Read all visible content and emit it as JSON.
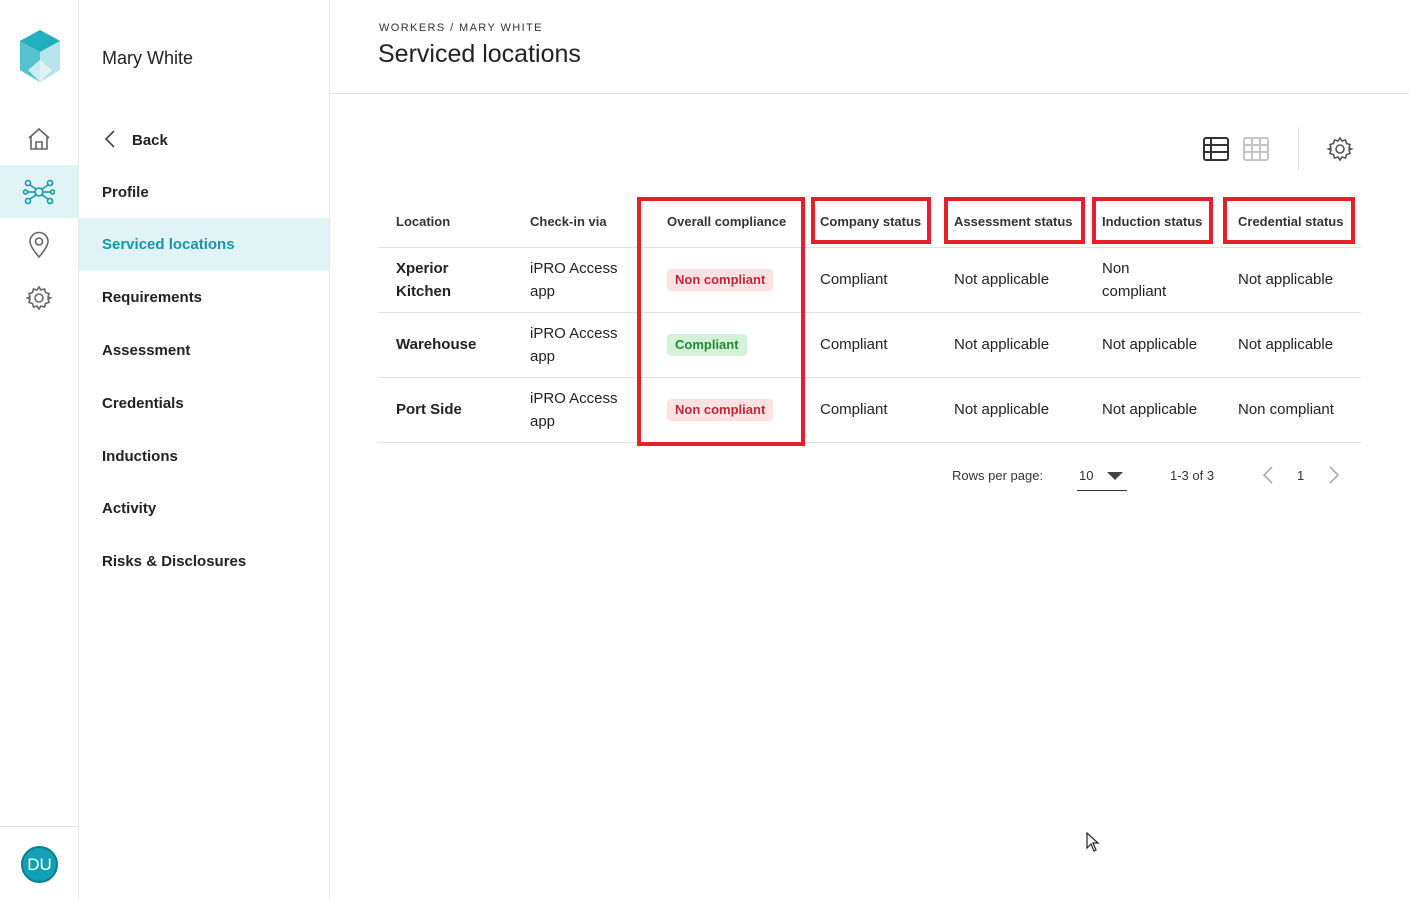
{
  "app": {
    "accent": "#1497a8",
    "highlight_color": "#e5202a"
  },
  "rail": {
    "logo": "app-logo",
    "items": [
      {
        "icon": "home-icon",
        "active": false
      },
      {
        "icon": "network-icon",
        "active": true
      },
      {
        "icon": "location-pin-icon",
        "active": false
      },
      {
        "icon": "gear-icon",
        "active": false
      }
    ],
    "avatar_initials": "DU"
  },
  "sidebar": {
    "worker_name": "Mary White",
    "back_label": "Back",
    "items": [
      {
        "label": "Profile",
        "active": false
      },
      {
        "label": "Serviced locations",
        "active": true
      },
      {
        "label": "Requirements",
        "active": false
      },
      {
        "label": "Assessment",
        "active": false
      },
      {
        "label": "Credentials",
        "active": false
      },
      {
        "label": "Inductions",
        "active": false
      },
      {
        "label": "Activity",
        "active": false
      },
      {
        "label": "Risks & Disclosures",
        "active": false
      }
    ]
  },
  "header": {
    "breadcrumb": "WORKERS / MARY WHITE",
    "title": "Serviced locations"
  },
  "toolbar": {
    "list_view_icon": "table-view-icon",
    "grid_view_icon": "grid-view-icon",
    "settings_icon": "gear-icon"
  },
  "table": {
    "columns": [
      "Location",
      "Check-in via",
      "Overall compliance",
      "Company status",
      "Assessment status",
      "Induction status",
      "Credential status"
    ],
    "rows": [
      {
        "location": "Xperior Kitchen",
        "checkin": "iPRO Access app",
        "overall": "Non compliant",
        "overall_status": "bad",
        "company": "Compliant",
        "assessment": "Not applicable",
        "induction": "Non compliant",
        "credential": "Not applicable"
      },
      {
        "location": "Warehouse",
        "checkin": "iPRO Access app",
        "overall": "Compliant",
        "overall_status": "good",
        "company": "Compliant",
        "assessment": "Not applicable",
        "induction": "Not applicable",
        "credential": "Not applicable"
      },
      {
        "location": "Port Side",
        "checkin": "iPRO Access app",
        "overall": "Non compliant",
        "overall_status": "bad",
        "company": "Compliant",
        "assessment": "Not applicable",
        "induction": "Not applicable",
        "credential": "Non compliant"
      }
    ]
  },
  "pagination": {
    "rows_per_page_label": "Rows per page:",
    "rows_per_page_value": "10",
    "range_label": "1-3 of 3",
    "page": "1"
  }
}
